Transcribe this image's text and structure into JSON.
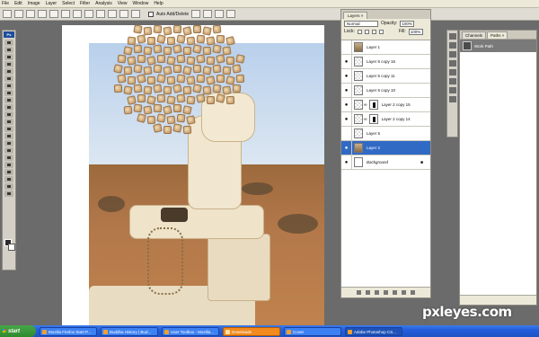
{
  "menu": [
    "File",
    "Edit",
    "Image",
    "Layer",
    "Select",
    "Filter",
    "Analysis",
    "View",
    "Window",
    "Help"
  ],
  "options_bar": {
    "auto_add_delete_label": "Auto Add/Delete"
  },
  "tools": {
    "logo": "Ps"
  },
  "layers_panel": {
    "tab_label": "Layers ×",
    "blend_mode": "Normal",
    "opacity_label": "Opacity:",
    "opacity_value": "100%",
    "lock_label": "Lock:",
    "fill_label": "Fill:",
    "fill_value": "100%",
    "rows": [
      {
        "name": "Layer 1",
        "visible": false,
        "thumb": "img",
        "mask": false,
        "selected": false
      },
      {
        "name": "Layer 5 copy 16",
        "visible": true,
        "thumb": "checker",
        "mask": false,
        "selected": false
      },
      {
        "name": "Layer 5 copy 11",
        "visible": true,
        "thumb": "checker",
        "mask": false,
        "selected": false
      },
      {
        "name": "Layer 5 copy 10",
        "visible": true,
        "thumb": "checker",
        "mask": false,
        "selected": false
      },
      {
        "name": "Layer 2 copy 15",
        "visible": true,
        "thumb": "checker",
        "mask": true,
        "selected": false
      },
      {
        "name": "Layer 2 copy 14",
        "visible": true,
        "thumb": "checker",
        "mask": true,
        "selected": false
      },
      {
        "name": "Layer 5",
        "visible": false,
        "thumb": "checker",
        "mask": false,
        "selected": false
      },
      {
        "name": "Layer 2",
        "visible": true,
        "thumb": "img",
        "mask": false,
        "selected": true
      },
      {
        "name": "Background",
        "visible": true,
        "thumb": "white",
        "mask": false,
        "selected": false,
        "locked": true
      }
    ]
  },
  "paths_panel": {
    "tabs": [
      "Channels",
      "Paths ×"
    ],
    "rows": [
      {
        "name": "Work Path"
      }
    ]
  },
  "taskbar": {
    "start_label": "start",
    "tasks": [
      {
        "label": "Mozilla Firefox Start P...",
        "style": "normal"
      },
      {
        "label": "Buddha History | Bud...",
        "style": "normal"
      },
      {
        "label": "User Toolbox - Mozilla...",
        "style": "normal"
      },
      {
        "label": "Downloads",
        "style": "orange"
      },
      {
        "label": "Covet",
        "style": "normal"
      },
      {
        "label": "Adobe Photoshop CS...",
        "style": "active"
      }
    ]
  },
  "watermark": "pxleyes.com",
  "colors": {
    "workspace": "#6b6b6b",
    "selection": "#316ac5",
    "taskbar": "#245edb"
  }
}
